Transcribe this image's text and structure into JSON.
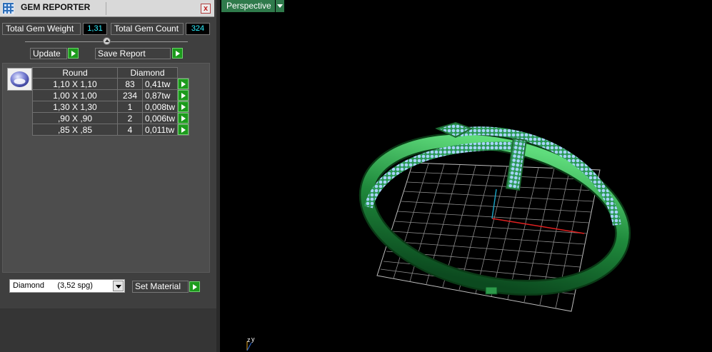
{
  "window": {
    "title": "GEM REPORTER",
    "close_label": "x"
  },
  "totals": {
    "weight_label": "Total Gem Weight",
    "weight_value": "1,31",
    "count_label": "Total Gem Count",
    "count_value": "324"
  },
  "buttons": {
    "update_label": "Update",
    "save_report_label": "Save Report",
    "set_material_label": "Set Material"
  },
  "table": {
    "headers": {
      "shape": "Round",
      "stone": "Diamond"
    },
    "rows": [
      {
        "size": "1,10 X 1,10",
        "count": "83",
        "weight": "0,41tw"
      },
      {
        "size": "1,00 X 1,00",
        "count": "234",
        "weight": "0,87tw"
      },
      {
        "size": "1,30 X 1,30",
        "count": "1",
        "weight": "0,008tw"
      },
      {
        "size": ",90 X ,90",
        "count": "2",
        "weight": "0,006tw"
      },
      {
        "size": ",85 X ,85",
        "count": "4",
        "weight": "0,011tw"
      }
    ]
  },
  "material": {
    "selected": "Diamond      (3,52 spg)"
  },
  "viewport": {
    "view_name": "Perspective",
    "axis_z": "z",
    "axis_y": "y"
  },
  "colors": {
    "accent_green": "#1c9a1c",
    "value_cyan": "#2ff0ff",
    "ring_green": "#1f8a3c",
    "gem_blue": "#8fc4ff"
  }
}
